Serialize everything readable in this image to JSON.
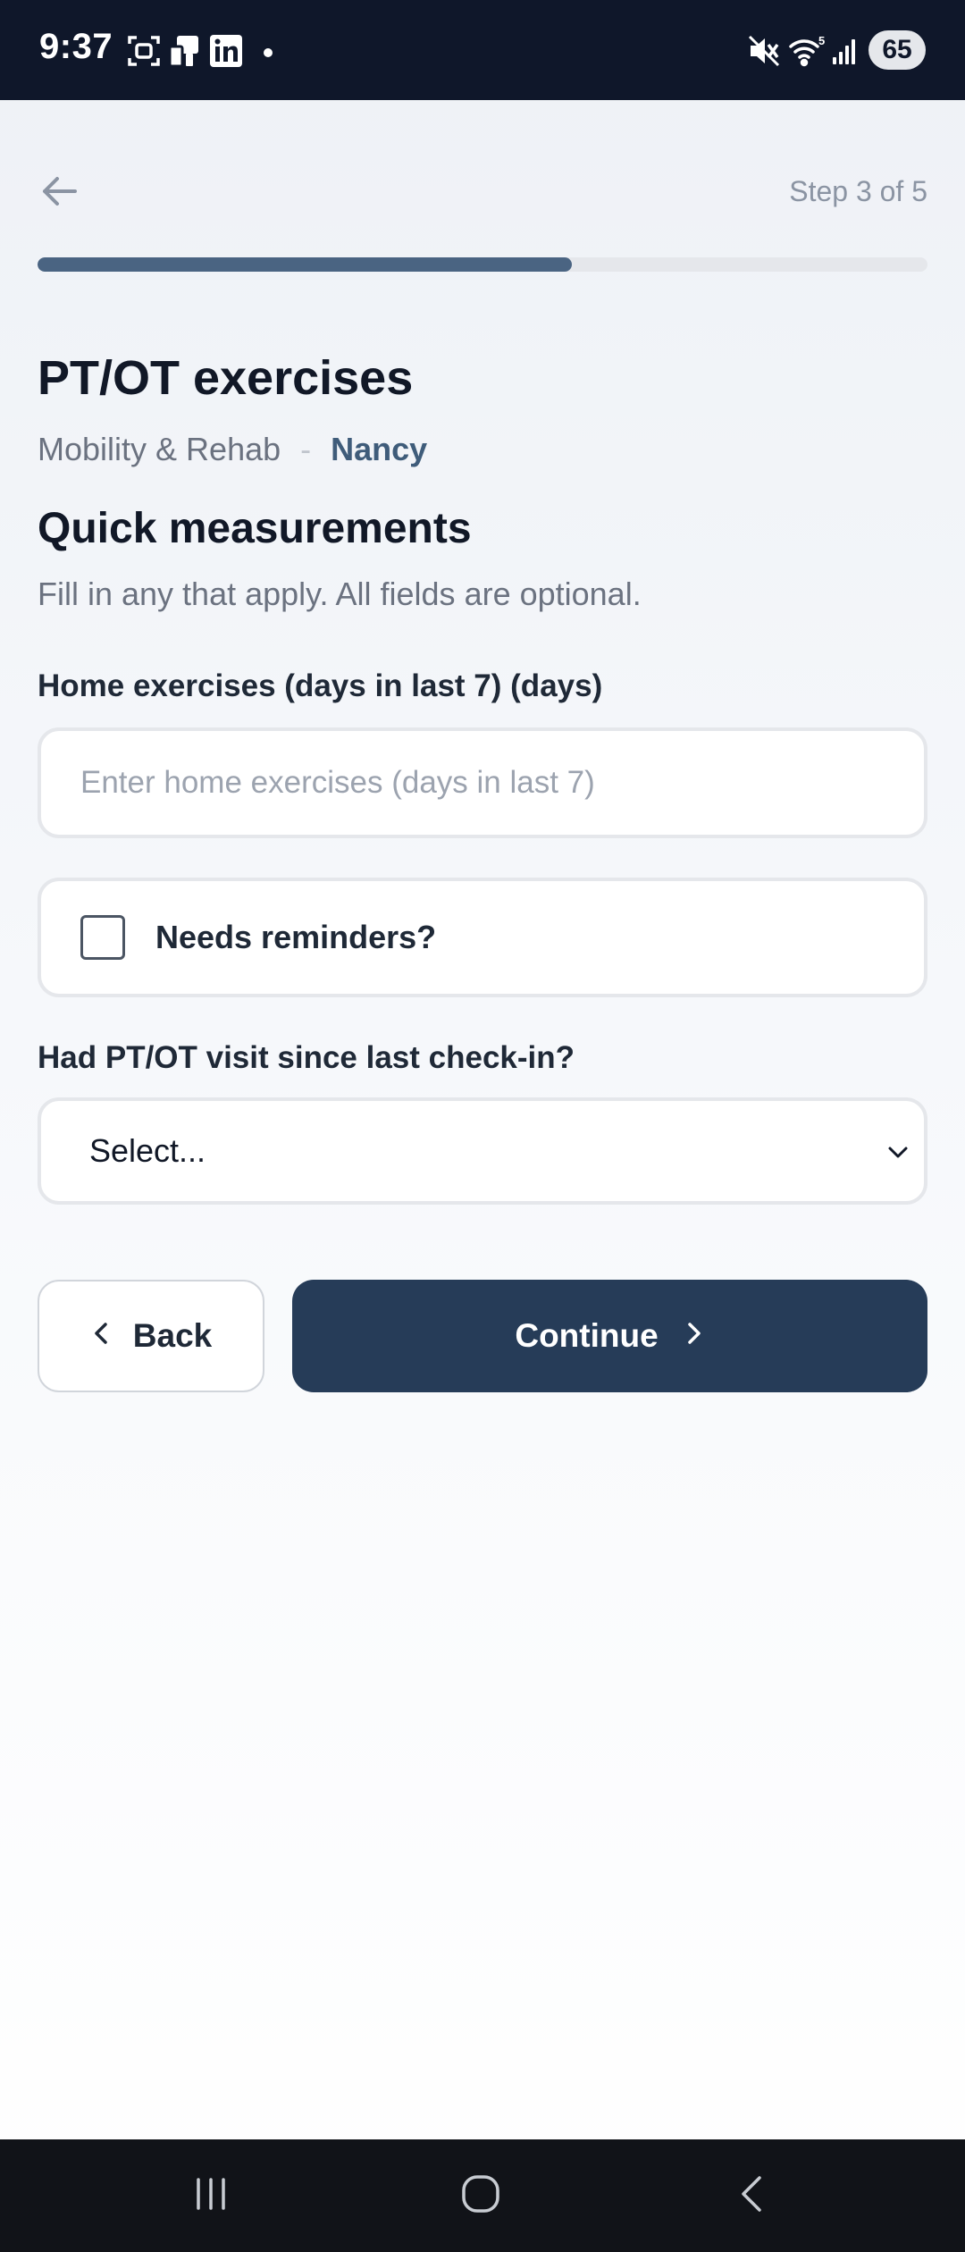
{
  "status_bar": {
    "time": "9:37",
    "battery": "65",
    "left_icons": [
      "screenshot-icon",
      "device-icon",
      "linkedin-icon"
    ],
    "right_icons": [
      "mute-icon",
      "wifi-icon",
      "signal-icon"
    ]
  },
  "header": {
    "step_label": "Step 3 of 5",
    "progress_fraction": 0.6
  },
  "page": {
    "title": "PT/OT exercises",
    "category": "Mobility & Rehab",
    "separator": "-",
    "person": "Nancy"
  },
  "section": {
    "title": "Quick measurements",
    "description": "Fill in any that apply. All fields are optional."
  },
  "fields": {
    "home_exercises": {
      "label": "Home exercises (days in last 7) (days)",
      "value": "",
      "placeholder": "Enter home exercises (days in last 7)"
    },
    "needs_reminders": {
      "label": "Needs reminders?",
      "checked": false
    },
    "pt_visit": {
      "label": "Had PT/OT visit since last check-in?",
      "selected": "Select..."
    }
  },
  "buttons": {
    "back": "Back",
    "continue": "Continue"
  },
  "colors": {
    "status_bar": "#0f172a",
    "progress_fill": "#4a6482",
    "primary_button": "#263c58",
    "accent_text": "#3f5c7a"
  }
}
